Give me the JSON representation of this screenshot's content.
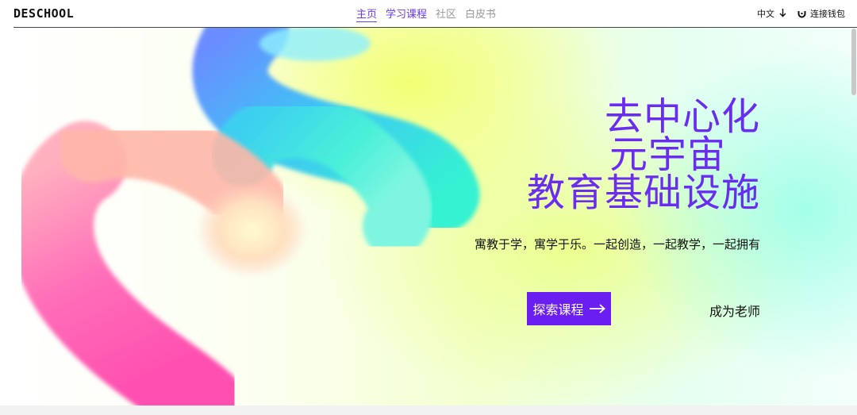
{
  "brand": {
    "logo_text": "DESCHOOL",
    "accent_color": "#6a1ff0"
  },
  "nav": {
    "items": [
      {
        "label": "主页",
        "active": true
      },
      {
        "label": "学习课程",
        "active": false
      },
      {
        "label": "社区",
        "active": false
      },
      {
        "label": "白皮书",
        "active": false
      }
    ]
  },
  "header_right": {
    "language_label": "中文",
    "language_icon": "arrow-down-icon",
    "wallet_label": "连接钱包",
    "wallet_icon": "wallet-icon"
  },
  "hero": {
    "headline": [
      "去中心化",
      "元宇宙",
      "教育基础设施"
    ],
    "tagline": "寓教于学，寓学于乐。一起创造，一起教学，一起拥有",
    "primary_button_label": "探索课程",
    "primary_button_icon": "arrow-right-icon",
    "secondary_link_label": "成为老师",
    "headline_color": "#6a2cf0"
  }
}
